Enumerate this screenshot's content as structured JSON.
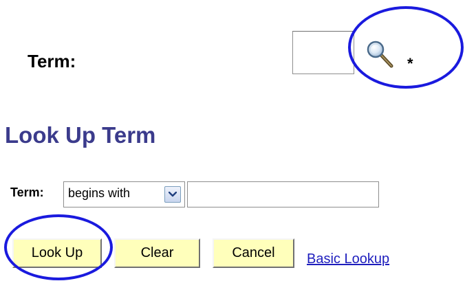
{
  "term_field": {
    "label": "Term:",
    "value": "",
    "required_marker": "*",
    "search_icon": "magnifying-glass-icon"
  },
  "lookup": {
    "title": "Look Up Term",
    "search_label": "Term:",
    "operator": "begins with",
    "search_value": "",
    "dropdown_icon": "chevron-down-icon"
  },
  "buttons": {
    "lookup": "Look Up",
    "clear": "Clear",
    "cancel": "Cancel",
    "basic_lookup": "Basic Lookup"
  },
  "colors": {
    "annotation_circle": "#1a1ade",
    "title": "#3b3b8c",
    "button_bg": "#ffffbb",
    "link": "#1d1dbd"
  }
}
